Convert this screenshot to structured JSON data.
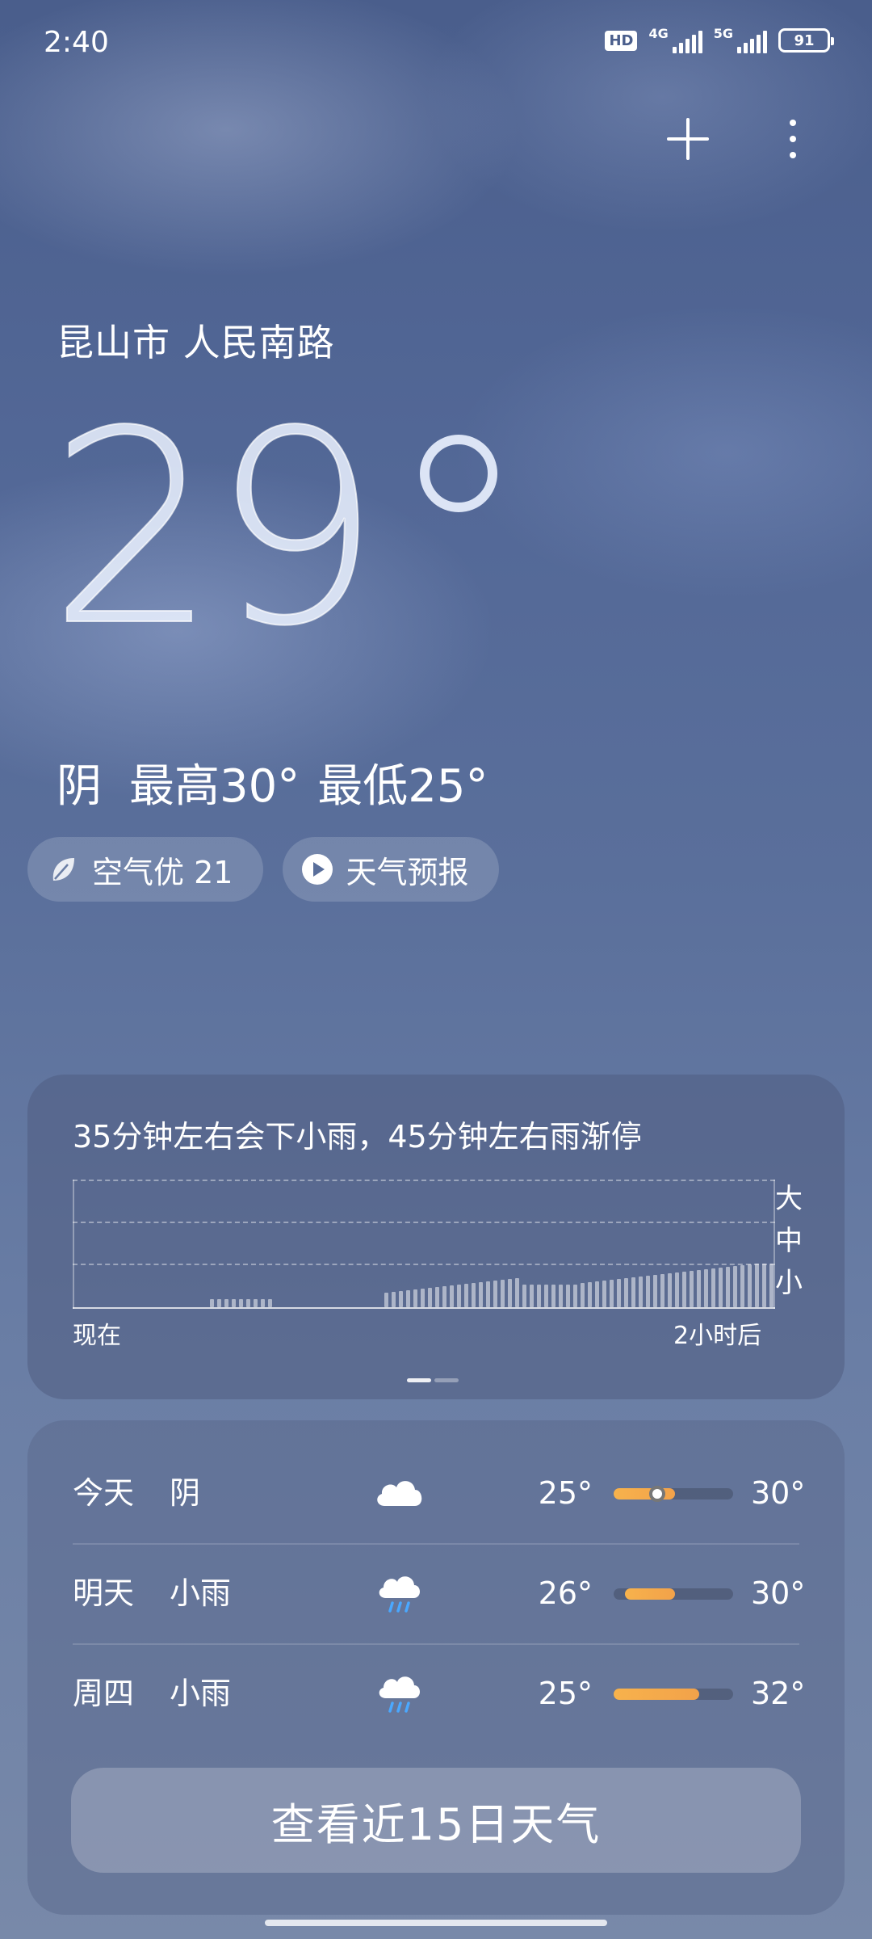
{
  "status_bar": {
    "time": "2:40",
    "hd": "HD",
    "net1": "4G",
    "net2": "5G",
    "battery": "91"
  },
  "header": {
    "add_icon": "plus-icon",
    "more_icon": "more-vertical-icon"
  },
  "current": {
    "location": "昆山市 人民南路",
    "temperature": "29",
    "condition": "阴",
    "high": "最高30°",
    "low": "最低25°"
  },
  "pills": {
    "air_quality": "空气优 21",
    "forecast_video": "天气预报"
  },
  "precipitation": {
    "title": "35分钟左右会下小雨，45分钟左右雨渐停",
    "level_heavy": "大",
    "level_medium": "中",
    "level_light": "小",
    "axis_start": "现在",
    "axis_end": "2小时后"
  },
  "forecast": {
    "rows": [
      {
        "day": "今天",
        "condition": "阴",
        "icon": "cloud-icon",
        "low": "25°",
        "high": "30°"
      },
      {
        "day": "明天",
        "condition": "小雨",
        "icon": "light-rain-icon",
        "low": "26°",
        "high": "30°"
      },
      {
        "day": "周四",
        "condition": "小雨",
        "icon": "light-rain-icon",
        "low": "25°",
        "high": "32°"
      }
    ],
    "more_button": "查看近15日天气"
  },
  "colors": {
    "accent_bar": "#f7b24c",
    "bg_top": "#4a5e8c",
    "bg_bottom": "#7889a9"
  }
}
